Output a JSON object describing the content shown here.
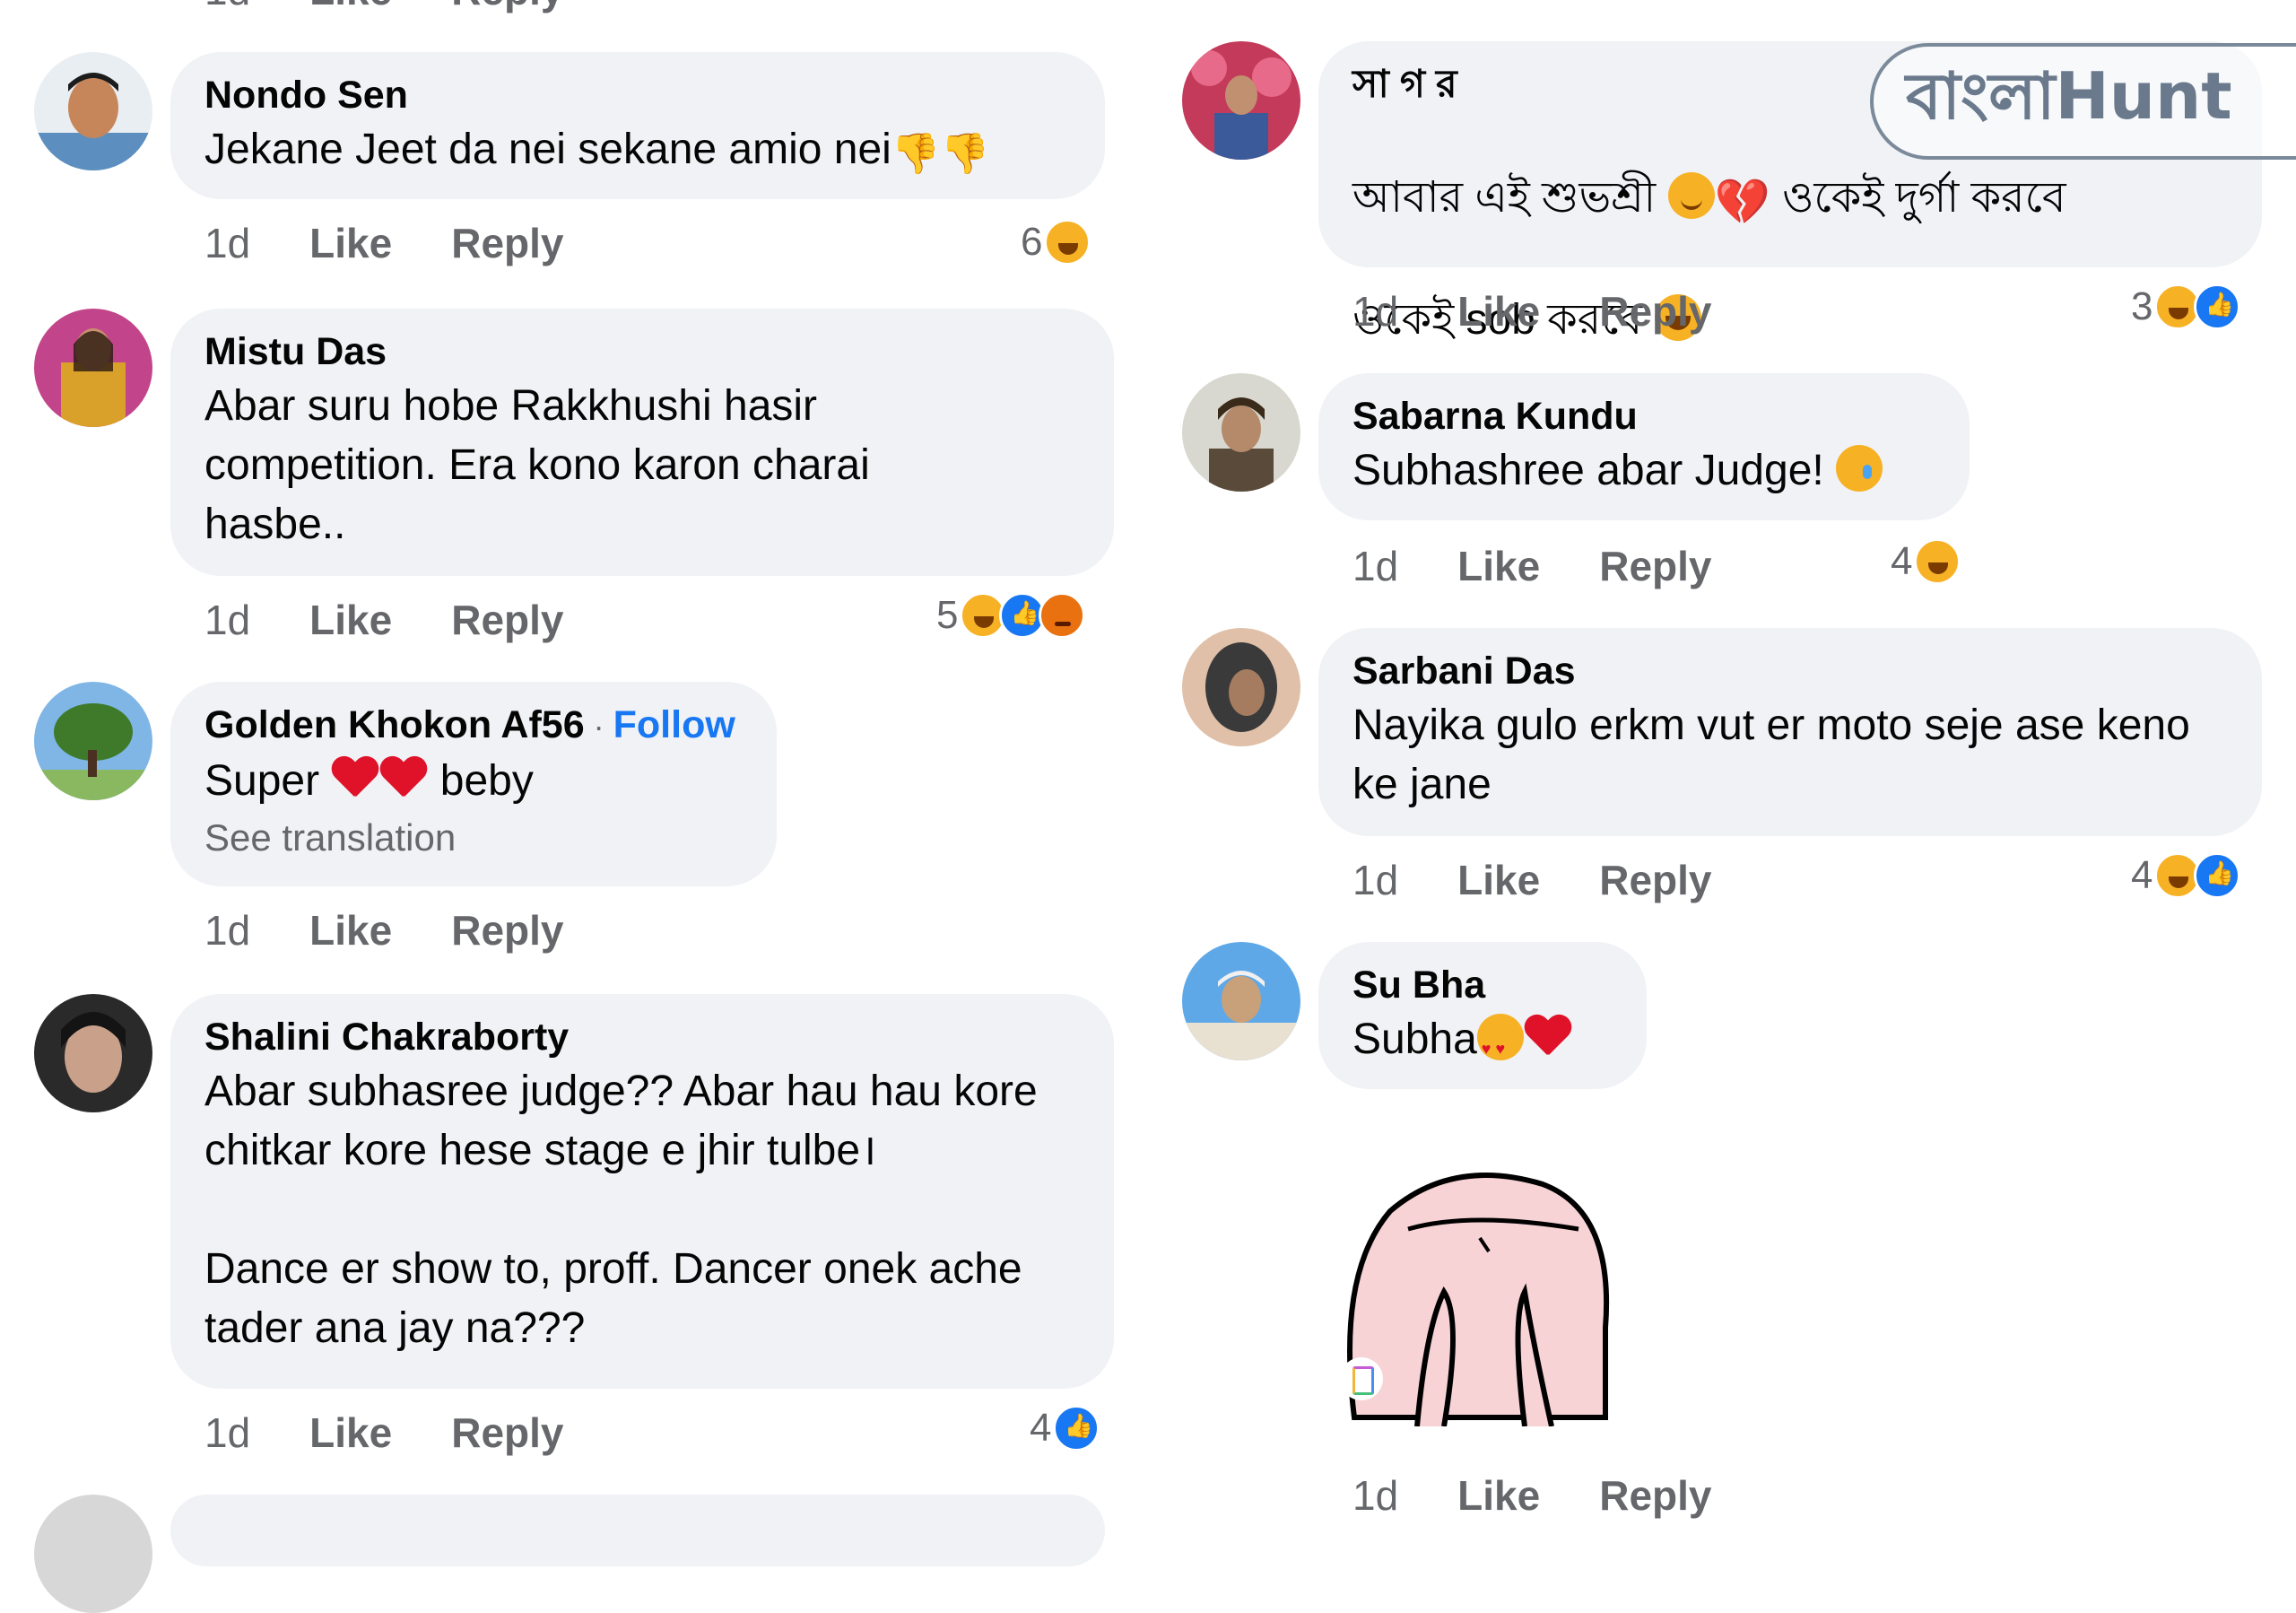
{
  "left_column": {
    "comments": [
      {
        "name": "Nondo Sen",
        "text": "Jekane Jeet da nei sekane amio nei",
        "time": "1d",
        "like": "Like",
        "reply": "Reply",
        "reaction_count": "6",
        "reactions": [
          "haha"
        ],
        "avatar_colors": [
          "#5c8fbf",
          "#c7865a"
        ]
      },
      {
        "name": "Mistu Das",
        "text": "Abar suru hobe Rakkhushi hasir competition. Era kono karon charai hasbe..",
        "time": "1d",
        "like": "Like",
        "reply": "Reply",
        "reaction_count": "5",
        "reactions": [
          "haha",
          "like",
          "angry"
        ],
        "avatar_colors": [
          "#d9a12a",
          "#c2448a"
        ]
      },
      {
        "name": "Golden Khokon Af56",
        "follow": "Follow",
        "separator": "·",
        "text_parts": [
          "Super",
          "beby"
        ],
        "see_translation": "See translation",
        "time": "1d",
        "like": "Like",
        "reply": "Reply",
        "avatar_colors": [
          "#7fb6e6",
          "#3f7a2a"
        ]
      },
      {
        "name": "Shalini Chakraborty",
        "text": "Abar subhasree judge?? Abar hau hau kore chitkar kore hese stage e jhir tulbe।\n\nDance er show to, proff. Dancer onek ache tader ana jay na???",
        "time": "1d",
        "like": "Like",
        "reply": "Reply",
        "reaction_count": "4",
        "reactions": [
          "like"
        ],
        "avatar_colors": [
          "#2a2a2a",
          "#c9a18a"
        ]
      }
    ]
  },
  "right_column": {
    "comments": [
      {
        "name": "সা গ র",
        "text_line1": "আবার এই শুভশ্রী",
        "text_line1_tail": "ওকেই দুর্গা করবে",
        "text_line2": "ওকেই sob করবে",
        "time": "1d",
        "like": "Like",
        "reply": "Reply",
        "reaction_count": "3",
        "reactions": [
          "haha",
          "like"
        ],
        "avatar_colors": [
          "#c43a5a",
          "#3a5a9a"
        ]
      },
      {
        "name": "Sabarna Kundu",
        "text": "Subhashree abar Judge!",
        "time": "1d",
        "like": "Like",
        "reply": "Reply",
        "reaction_count": "4",
        "reactions": [
          "haha"
        ],
        "avatar_colors": [
          "#d8d8d0",
          "#5a4a3a"
        ]
      },
      {
        "name": "Sarbani Das",
        "text": "Nayika gulo erkm vut er moto seje ase keno ke jane",
        "time": "1d",
        "like": "Like",
        "reply": "Reply",
        "reaction_count": "4",
        "reactions": [
          "haha",
          "like"
        ],
        "avatar_colors": [
          "#3a3a3a",
          "#e0c0a8"
        ]
      },
      {
        "name": "Su Bha",
        "text": "Subha",
        "time": "1d",
        "like": "Like",
        "reply": "Reply",
        "avatar_colors": [
          "#5fa8e8",
          "#c8a07a"
        ]
      }
    ]
  },
  "watermark": {
    "text": "বাংলাHunt"
  },
  "colors": {
    "bubble": "#f0f2f5",
    "secondary_text": "#65676b",
    "follow_blue": "#1877f2",
    "sticker_pink": "#f7d3d6"
  }
}
